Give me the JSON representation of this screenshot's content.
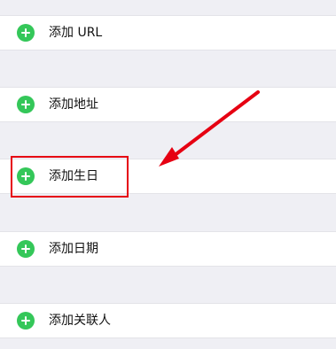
{
  "list": {
    "items": [
      {
        "label": "添加 URL",
        "icon": "plus-circle-icon"
      },
      {
        "label": "添加地址",
        "icon": "plus-circle-icon"
      },
      {
        "label": "添加生日",
        "icon": "plus-circle-icon"
      },
      {
        "label": "添加日期",
        "icon": "plus-circle-icon"
      },
      {
        "label": "添加关联人",
        "icon": "plus-circle-icon"
      }
    ]
  },
  "colors": {
    "add_icon": "#34c759",
    "annotation": "#e60012",
    "background": "#efeff4"
  }
}
